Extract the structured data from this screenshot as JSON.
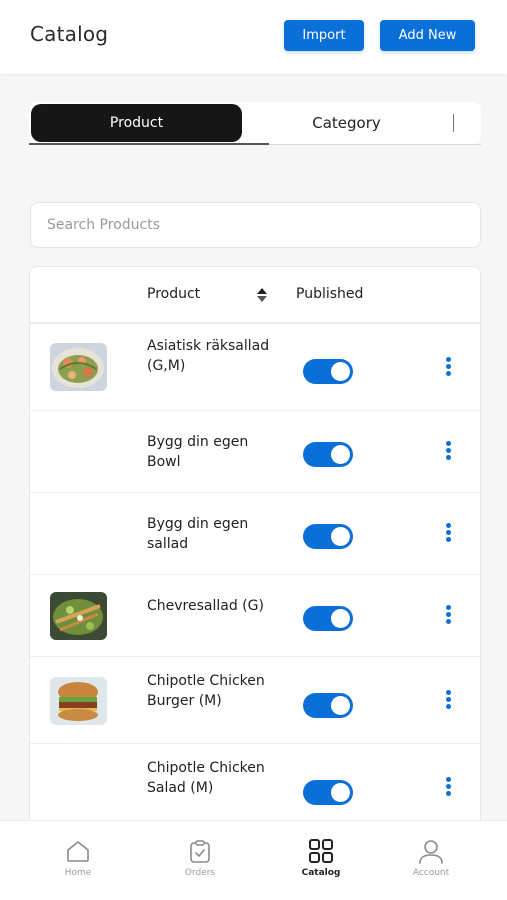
{
  "header": {
    "title": "Catalog",
    "import_label": "Import",
    "add_new_label": "Add New"
  },
  "tabs": {
    "product": "Product",
    "category": "Category",
    "active": "Product"
  },
  "search": {
    "placeholder": "Search Products",
    "value": ""
  },
  "table": {
    "columns": [
      "Product",
      "Published"
    ],
    "rows": [
      {
        "name": "Asiatisk räksallad (G,M)",
        "has_image": true,
        "published": true
      },
      {
        "name": "Bygg din egen Bowl",
        "has_image": false,
        "published": true
      },
      {
        "name": "Bygg din egen sallad",
        "has_image": false,
        "published": true
      },
      {
        "name": "Chevresallad (G)",
        "has_image": true,
        "published": true
      },
      {
        "name": "Chipotle Chicken Burger (M)",
        "has_image": true,
        "published": true
      },
      {
        "name": "Chipotle Chicken Salad (M)",
        "has_image": false,
        "published": true
      }
    ]
  },
  "nav": {
    "items": [
      {
        "label": "Home",
        "icon": "home-icon",
        "active": false
      },
      {
        "label": "Orders",
        "icon": "clipboard-check-icon",
        "active": false
      },
      {
        "label": "Catalog",
        "icon": "grid-icon",
        "active": true
      },
      {
        "label": "Account",
        "icon": "user-icon",
        "active": false
      }
    ]
  },
  "colors": {
    "accent": "#0a6fd6",
    "tab_active_bg": "#161616",
    "background": "#f6f6f7"
  }
}
